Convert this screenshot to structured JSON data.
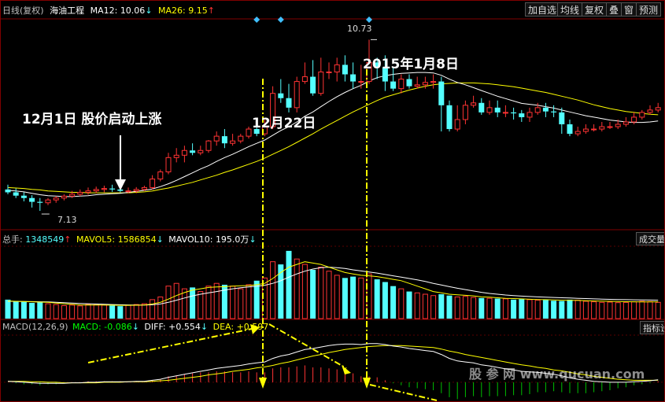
{
  "stock": {
    "period_label": "日线(复权)",
    "name": "海油工程",
    "ma12_label": "MA12:",
    "ma12_value": "10.06",
    "ma12_arrow": "↓",
    "ma26_label": "MA26:",
    "ma26_value": "9.15",
    "ma26_arrow": "↑"
  },
  "toolbar": [
    {
      "id": "add",
      "label": "加自选"
    },
    {
      "id": "avg",
      "label": "均线"
    },
    {
      "id": "adj",
      "label": "复权"
    },
    {
      "id": "overlay",
      "label": "叠"
    },
    {
      "id": "window",
      "label": "窗"
    },
    {
      "id": "forecast",
      "label": "预测"
    }
  ],
  "volume_header": {
    "total_label": "总手:",
    "total_value": "1348549",
    "total_arrow": "↑",
    "mavol5_label": "MAVOL5:",
    "mavol5_value": "1586854",
    "mavol5_arrow": "↓",
    "mavol10_label": "MAVOL10:",
    "mavol10_value": "195.0万",
    "mavol10_arrow": "↓",
    "button": "成交量"
  },
  "macd_header": {
    "name": "MACD(12,26,9)",
    "macd_label": "MACD:",
    "macd_value": "-0.086",
    "macd_arrow": "↓",
    "diff_label": "DIFF:",
    "diff_value": "+0.554",
    "diff_arrow": "↓",
    "dea_label": "DEA:",
    "dea_value": "+0.597",
    "button": "指标设"
  },
  "annotations": {
    "start": "12月1日 股价启动上涨",
    "dec22": "12月22日",
    "jan8": "2015年1月8日",
    "high_label": "10.73",
    "low_label": "7.13"
  },
  "watermark": "股 参 网  www.qucuan.com",
  "colors": {
    "up": "#ff3333",
    "down": "#54ffff",
    "ma12": "#ffffff",
    "ma26": "#ffff00",
    "annotation": "#ffff00",
    "marker": "#40c0ff"
  },
  "chart_data": [
    {
      "type": "candlestick",
      "title": "海油工程 日线(复权)",
      "series_labels": [
        "MA12",
        "MA26"
      ],
      "ylim": [
        6.8,
        11.1
      ],
      "open": [
        7.58,
        7.52,
        7.45,
        7.4,
        7.32,
        7.3,
        7.36,
        7.4,
        7.44,
        7.48,
        7.52,
        7.55,
        7.58,
        7.6,
        7.58,
        7.55,
        7.55,
        7.58,
        7.62,
        7.8,
        7.95,
        8.25,
        8.3,
        8.4,
        8.35,
        8.4,
        8.6,
        8.7,
        8.55,
        8.6,
        8.7,
        8.85,
        8.75,
        8.9,
        9.6,
        9.5,
        9.3,
        9.85,
        9.95,
        9.6,
        10.05,
        10.05,
        10.2,
        10.0,
        9.85,
        9.85,
        10.25,
        10.15,
        9.85,
        9.7,
        9.9,
        9.75,
        9.78,
        9.83,
        9.85,
        9.35,
        8.85,
        9.05,
        9.35,
        9.4,
        9.2,
        9.3,
        9.2,
        9.2,
        9.18,
        9.1,
        9.2,
        9.3,
        9.22,
        9.2,
        8.95,
        8.75,
        8.8,
        8.85,
        8.85,
        8.9,
        8.9,
        8.95,
        9.0,
        9.1,
        9.2,
        9.25
      ],
      "high": [
        7.68,
        7.6,
        7.52,
        7.46,
        7.4,
        7.4,
        7.44,
        7.48,
        7.55,
        7.58,
        7.62,
        7.64,
        7.66,
        7.68,
        7.66,
        7.62,
        7.63,
        7.66,
        7.88,
        8.0,
        8.35,
        8.45,
        8.5,
        8.55,
        8.5,
        8.62,
        8.8,
        8.85,
        8.75,
        8.75,
        8.9,
        9.0,
        9.05,
        9.75,
        9.9,
        9.8,
        9.95,
        10.25,
        10.3,
        10.35,
        10.25,
        10.35,
        10.4,
        10.25,
        10.2,
        10.73,
        10.35,
        10.4,
        10.15,
        10.0,
        10.0,
        9.95,
        9.95,
        10.0,
        9.95,
        9.45,
        9.35,
        9.45,
        9.55,
        9.5,
        9.45,
        9.45,
        9.35,
        9.3,
        9.25,
        9.3,
        9.4,
        9.4,
        9.35,
        9.3,
        9.05,
        8.9,
        8.95,
        8.95,
        9.0,
        9.0,
        9.05,
        9.1,
        9.2,
        9.25,
        9.35,
        9.4
      ],
      "low": [
        7.48,
        7.4,
        7.33,
        7.2,
        7.13,
        7.25,
        7.3,
        7.35,
        7.4,
        7.44,
        7.47,
        7.5,
        7.52,
        7.53,
        7.52,
        7.5,
        7.5,
        7.55,
        7.58,
        7.75,
        7.9,
        8.15,
        8.15,
        8.3,
        8.3,
        8.35,
        8.5,
        8.45,
        8.5,
        8.55,
        8.65,
        8.7,
        8.7,
        8.85,
        9.4,
        9.2,
        9.2,
        9.8,
        9.55,
        9.55,
        9.9,
        9.85,
        9.85,
        9.7,
        9.7,
        9.8,
        9.9,
        9.65,
        9.65,
        9.6,
        9.7,
        9.7,
        9.7,
        9.7,
        8.8,
        8.8,
        8.8,
        8.95,
        9.3,
        9.15,
        9.15,
        9.1,
        9.1,
        9.05,
        9.0,
        9.0,
        9.15,
        9.1,
        9.1,
        8.75,
        8.7,
        8.7,
        8.75,
        8.8,
        8.8,
        8.85,
        8.85,
        8.9,
        8.95,
        9.05,
        9.15,
        9.2
      ],
      "close": [
        7.52,
        7.45,
        7.4,
        7.32,
        7.3,
        7.36,
        7.4,
        7.44,
        7.48,
        7.52,
        7.55,
        7.58,
        7.6,
        7.58,
        7.55,
        7.55,
        7.58,
        7.62,
        7.8,
        7.95,
        8.25,
        8.3,
        8.4,
        8.35,
        8.4,
        8.6,
        8.7,
        8.55,
        8.6,
        8.7,
        8.85,
        8.75,
        8.9,
        9.6,
        9.5,
        9.3,
        9.85,
        9.95,
        9.6,
        10.05,
        10.05,
        10.2,
        10.0,
        9.85,
        9.85,
        10.25,
        10.15,
        9.85,
        9.7,
        9.9,
        9.75,
        9.78,
        9.83,
        9.85,
        9.35,
        8.85,
        9.05,
        9.35,
        9.4,
        9.2,
        9.3,
        9.2,
        9.2,
        9.18,
        9.1,
        9.2,
        9.3,
        9.22,
        9.2,
        8.95,
        8.75,
        8.8,
        8.85,
        8.85,
        8.9,
        8.9,
        8.95,
        9.0,
        9.1,
        9.2,
        9.25,
        9.3
      ],
      "ma12": [
        7.56,
        7.55,
        7.53,
        7.5,
        7.47,
        7.45,
        7.44,
        7.43,
        7.43,
        7.44,
        7.45,
        7.47,
        7.48,
        7.49,
        7.5,
        7.52,
        7.54,
        7.56,
        7.59,
        7.64,
        7.7,
        7.77,
        7.85,
        7.93,
        8.01,
        8.08,
        8.17,
        8.25,
        8.32,
        8.4,
        8.48,
        8.55,
        8.62,
        8.72,
        8.82,
        8.9,
        9.0,
        9.12,
        9.21,
        9.32,
        9.43,
        9.53,
        9.62,
        9.7,
        9.77,
        9.86,
        9.93,
        9.97,
        10.0,
        10.02,
        10.03,
        10.04,
        10.04,
        10.03,
        9.98,
        9.9,
        9.83,
        9.78,
        9.72,
        9.66,
        9.6,
        9.54,
        9.49,
        9.44,
        9.39,
        9.37,
        9.35,
        9.32,
        9.29,
        9.25,
        9.21,
        9.17,
        9.13,
        9.1,
        9.07,
        9.04,
        9.02,
        9.0,
        8.99,
        8.99,
        9.0,
        9.02
      ],
      "ma26": [
        7.62,
        7.61,
        7.6,
        7.58,
        7.57,
        7.55,
        7.54,
        7.53,
        7.52,
        7.52,
        7.51,
        7.51,
        7.51,
        7.51,
        7.51,
        7.51,
        7.52,
        7.53,
        7.55,
        7.58,
        7.61,
        7.65,
        7.69,
        7.73,
        7.78,
        7.83,
        7.88,
        7.94,
        7.99,
        8.05,
        8.11,
        8.17,
        8.24,
        8.32,
        8.4,
        8.48,
        8.57,
        8.66,
        8.75,
        8.85,
        8.94,
        9.03,
        9.12,
        9.21,
        9.29,
        9.37,
        9.45,
        9.52,
        9.57,
        9.62,
        9.67,
        9.71,
        9.75,
        9.78,
        9.8,
        9.81,
        9.82,
        9.82,
        9.82,
        9.81,
        9.8,
        9.78,
        9.76,
        9.74,
        9.71,
        9.68,
        9.65,
        9.62,
        9.58,
        9.54,
        9.5,
        9.46,
        9.41,
        9.36,
        9.32,
        9.28,
        9.25,
        9.22,
        9.2,
        9.18,
        9.16,
        9.15
      ],
      "high_marker": "10.73",
      "low_marker": "7.13"
    },
    {
      "type": "bar",
      "title": "成交量",
      "series_labels": [
        "MAVOL5",
        "MAVOL10"
      ],
      "ylim": [
        0,
        2700000
      ],
      "values": [
        700000,
        650000,
        620000,
        580000,
        600000,
        550000,
        520000,
        480000,
        500000,
        470000,
        520000,
        510000,
        500000,
        480000,
        460000,
        490000,
        520000,
        550000,
        700000,
        800000,
        1200000,
        1300000,
        1100000,
        1150000,
        1000000,
        1200000,
        1300000,
        1250000,
        1200000,
        1100000,
        1250000,
        1400000,
        1500000,
        2100000,
        2000000,
        2500000,
        2200000,
        2000000,
        1800000,
        1900000,
        1750000,
        1600000,
        1500000,
        1550000,
        1500000,
        1650000,
        1450000,
        1350000,
        1200000,
        1100000,
        1000000,
        950000,
        900000,
        850000,
        900000,
        850000,
        800000,
        820000,
        780000,
        760000,
        750000,
        740000,
        730000,
        700000,
        720000,
        700000,
        680000,
        690000,
        660000,
        650000,
        700000,
        680000,
        640000,
        620000,
        600000,
        610000,
        590000,
        600000,
        620000,
        640000,
        630000,
        600000
      ],
      "mavol5": [
        650000,
        640000,
        630000,
        620000,
        610000,
        600000,
        575000,
        550000,
        530000,
        505000,
        500000,
        500000,
        498000,
        496000,
        492000,
        492000,
        494000,
        500000,
        540000,
        600000,
        720000,
        850000,
        960000,
        1050000,
        1100000,
        1150000,
        1170000,
        1180000,
        1200000,
        1210000,
        1220000,
        1250000,
        1300000,
        1480000,
        1700000,
        1900000,
        2000000,
        2100000,
        2050000,
        2000000,
        1900000,
        1800000,
        1700000,
        1650000,
        1600000,
        1580000,
        1550000,
        1500000,
        1450000,
        1400000,
        1300000,
        1200000,
        1100000,
        1000000,
        950000,
        900000,
        880000,
        860000,
        840000,
        800000,
        790000,
        770000,
        750000,
        740000,
        730000,
        715000,
        705000,
        700000,
        690000,
        680000,
        675000,
        670000,
        660000,
        650000,
        645000,
        640000,
        630000,
        625000,
        620000,
        615000,
        618000,
        620000
      ],
      "mavol10": [
        640000,
        636000,
        632000,
        628000,
        622000,
        615000,
        605000,
        590000,
        575000,
        560000,
        550000,
        540000,
        530000,
        520000,
        512000,
        505000,
        502000,
        500000,
        510000,
        540000,
        600000,
        680000,
        760000,
        840000,
        900000,
        950000,
        1000000,
        1050000,
        1100000,
        1140000,
        1170000,
        1200000,
        1230000,
        1300000,
        1400000,
        1530000,
        1650000,
        1750000,
        1830000,
        1880000,
        1900000,
        1880000,
        1850000,
        1800000,
        1760000,
        1720000,
        1680000,
        1630000,
        1580000,
        1530000,
        1480000,
        1430000,
        1370000,
        1300000,
        1240000,
        1180000,
        1120000,
        1070000,
        1020000,
        970000,
        930000,
        900000,
        870000,
        850000,
        830000,
        815000,
        800000,
        790000,
        780000,
        770000,
        760000,
        750000,
        740000,
        730000,
        720000,
        712000,
        705000,
        700000,
        695000,
        690000,
        685000,
        680000
      ]
    },
    {
      "type": "line",
      "title": "MACD(12,26,9)",
      "series_labels": [
        "DIFF",
        "DEA",
        "MACD"
      ],
      "ylim": [
        -0.35,
        0.95
      ],
      "diff": [
        0.02,
        0.01,
        0.0,
        -0.01,
        -0.02,
        -0.02,
        -0.02,
        -0.02,
        -0.01,
        -0.01,
        0.0,
        0.0,
        0.01,
        0.01,
        0.01,
        0.01,
        0.02,
        0.02,
        0.04,
        0.06,
        0.1,
        0.13,
        0.16,
        0.19,
        0.22,
        0.25,
        0.28,
        0.3,
        0.32,
        0.34,
        0.37,
        0.39,
        0.41,
        0.48,
        0.53,
        0.56,
        0.61,
        0.66,
        0.68,
        0.71,
        0.74,
        0.76,
        0.77,
        0.77,
        0.76,
        0.78,
        0.78,
        0.76,
        0.73,
        0.71,
        0.68,
        0.66,
        0.64,
        0.62,
        0.56,
        0.48,
        0.43,
        0.41,
        0.39,
        0.35,
        0.33,
        0.3,
        0.27,
        0.25,
        0.22,
        0.21,
        0.2,
        0.18,
        0.16,
        0.13,
        0.09,
        0.06,
        0.04,
        0.02,
        0.01,
        0.0,
        0.0,
        0.0,
        0.01,
        0.02,
        0.03,
        0.05
      ],
      "dea": [
        0.02,
        0.02,
        0.02,
        0.01,
        0.01,
        0.0,
        0.0,
        -0.01,
        -0.01,
        -0.01,
        -0.01,
        -0.01,
        0.0,
        0.0,
        0.0,
        0.01,
        0.01,
        0.01,
        0.02,
        0.03,
        0.04,
        0.06,
        0.08,
        0.1,
        0.12,
        0.15,
        0.17,
        0.19,
        0.22,
        0.24,
        0.26,
        0.29,
        0.31,
        0.34,
        0.38,
        0.41,
        0.45,
        0.49,
        0.53,
        0.56,
        0.6,
        0.63,
        0.66,
        0.68,
        0.7,
        0.72,
        0.73,
        0.74,
        0.74,
        0.74,
        0.73,
        0.72,
        0.71,
        0.7,
        0.67,
        0.63,
        0.6,
        0.56,
        0.53,
        0.5,
        0.47,
        0.44,
        0.41,
        0.38,
        0.35,
        0.33,
        0.3,
        0.28,
        0.25,
        0.23,
        0.2,
        0.17,
        0.15,
        0.12,
        0.1,
        0.08,
        0.06,
        0.05,
        0.04,
        0.04,
        0.04,
        0.04
      ],
      "macd": [
        0.0,
        -0.02,
        -0.04,
        -0.04,
        -0.06,
        -0.04,
        -0.04,
        -0.02,
        0.0,
        0.0,
        0.02,
        0.02,
        0.02,
        0.02,
        0.02,
        0.0,
        0.02,
        0.02,
        0.04,
        0.06,
        0.12,
        0.14,
        0.16,
        0.18,
        0.2,
        0.2,
        0.22,
        0.22,
        0.2,
        0.2,
        0.22,
        0.2,
        0.2,
        0.28,
        0.3,
        0.3,
        0.32,
        0.34,
        0.3,
        0.3,
        0.28,
        0.26,
        0.22,
        0.18,
        0.12,
        0.12,
        0.1,
        0.04,
        -0.02,
        -0.06,
        -0.1,
        -0.12,
        -0.14,
        -0.16,
        -0.22,
        -0.3,
        -0.34,
        -0.3,
        -0.28,
        -0.3,
        -0.28,
        -0.28,
        -0.28,
        -0.26,
        -0.26,
        -0.24,
        -0.2,
        -0.2,
        -0.18,
        -0.2,
        -0.22,
        -0.22,
        -0.22,
        -0.2,
        -0.18,
        -0.16,
        -0.12,
        -0.1,
        -0.06,
        -0.04,
        -0.02,
        0.02
      ]
    }
  ]
}
